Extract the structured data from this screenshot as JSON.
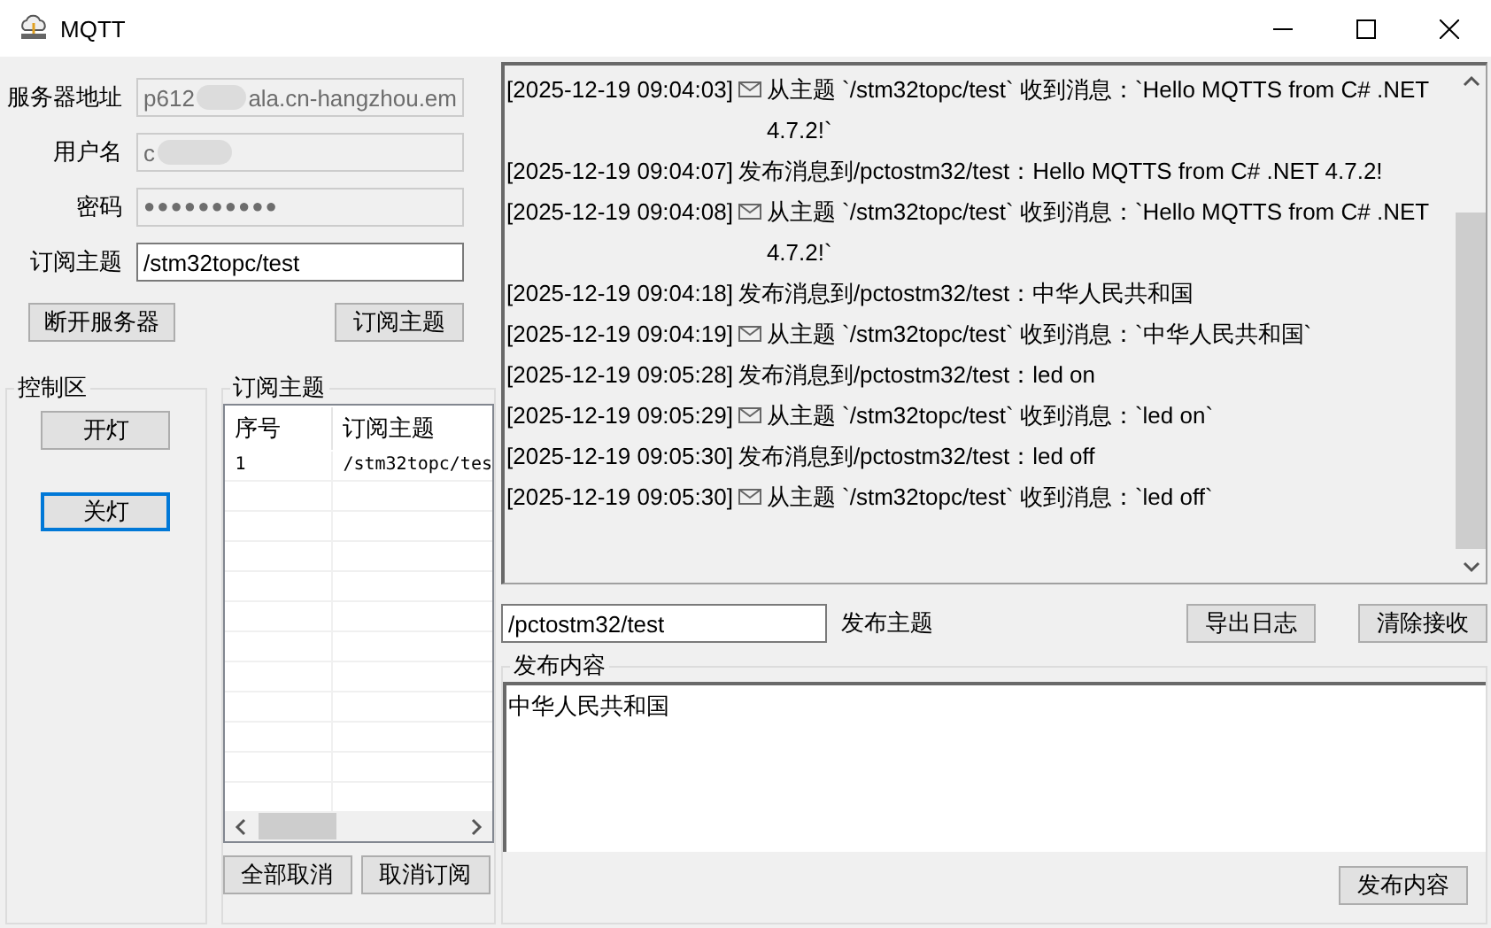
{
  "window": {
    "title": "MQTT"
  },
  "connection": {
    "fields": [
      {
        "label": "服务器地址",
        "value_start": "p612",
        "value_end": "ala.cn-hangzhou.em",
        "kind": "blurred",
        "editable": false
      },
      {
        "label": "用户名",
        "value_start": "c",
        "kind": "blurred",
        "editable": false
      },
      {
        "label": "密码",
        "value_start": "●●●●●●●●●●",
        "kind": "password",
        "editable": false
      },
      {
        "label": "订阅主题",
        "value_start": "/stm32topc/test",
        "kind": "text",
        "editable": true
      }
    ],
    "buttons": [
      "断开服务器",
      "订阅主题"
    ]
  },
  "control_area": {
    "title": "控制区",
    "buttons": [
      {
        "label": "开灯",
        "focused": false
      },
      {
        "label": "关灯",
        "focused": true
      }
    ]
  },
  "subscriptions": {
    "title": "订阅主题",
    "columns": [
      "序号",
      "订阅主题"
    ],
    "rows": [
      [
        "1",
        "/stm32topc/tes"
      ]
    ],
    "buttons": [
      "全部取消",
      "取消订阅"
    ]
  },
  "log": [
    {
      "time": "[2025-12-19 09:04:03]",
      "kind": "received",
      "text": "从主题 `/stm32topc/test` 收到消息：`Hello MQTTS from C# .NET 4.7.2!`"
    },
    {
      "time": "[2025-12-19 09:04:07]",
      "kind": "sent",
      "text": "发布消息到/pctostm32/test：Hello MQTTS from C# .NET 4.7.2!"
    },
    {
      "time": "[2025-12-19 09:04:08]",
      "kind": "received",
      "text": "从主题 `/stm32topc/test` 收到消息：`Hello MQTTS from C# .NET 4.7.2!`"
    },
    {
      "time": "[2025-12-19 09:04:18]",
      "kind": "sent",
      "text": "发布消息到/pctostm32/test：中华人民共和国"
    },
    {
      "time": "[2025-12-19 09:04:19]",
      "kind": "received",
      "text": "从主题 `/stm32topc/test` 收到消息：`中华人民共和国`"
    },
    {
      "time": "[2025-12-19 09:05:28]",
      "kind": "sent",
      "text": "发布消息到/pctostm32/test：led on"
    },
    {
      "time": "[2025-12-19 09:05:29]",
      "kind": "received",
      "text": "从主题 `/stm32topc/test` 收到消息：`led on`"
    },
    {
      "time": "[2025-12-19 09:05:30]",
      "kind": "sent",
      "text": "发布消息到/pctostm32/test：led off"
    },
    {
      "time": "[2025-12-19 09:05:30]",
      "kind": "received",
      "text": "从主题 `/stm32topc/test` 收到消息：`led off`"
    }
  ],
  "publish": {
    "topic": "/pctostm32/test",
    "topic_label": "发布主题",
    "buttons": [
      "导出日志",
      "清除接收"
    ],
    "content_title": "发布内容",
    "content": "中华人民共和国",
    "send_button": "发布内容"
  }
}
